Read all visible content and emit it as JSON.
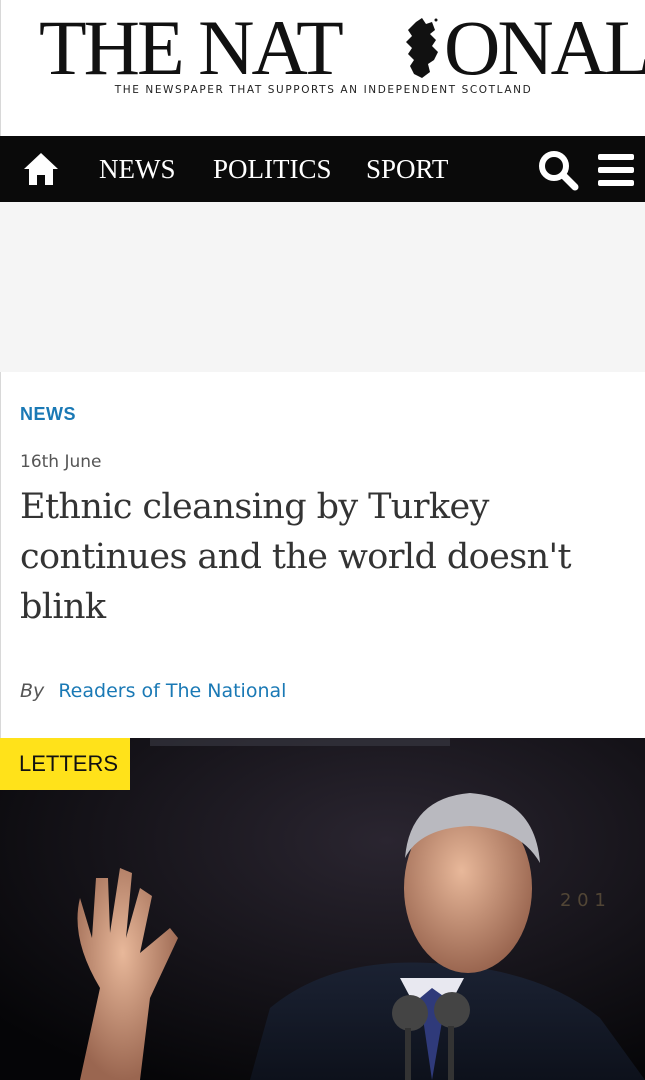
{
  "masthead": {
    "logo_text": "THE NATIONAL",
    "tagline": "THE NEWSPAPER THAT SUPPORTS AN INDEPENDENT SCOTLAND"
  },
  "nav": {
    "items": [
      "NEWS",
      "POLITICS",
      "SPORT"
    ],
    "icons": [
      "home-icon",
      "search-icon",
      "menu-icon"
    ]
  },
  "article": {
    "section": "NEWS",
    "date": "16th June",
    "headline": "Ethnic cleansing by Turkey continues and the world doesn't blink",
    "byline_prefix": "By",
    "author": "Readers of The National"
  },
  "hero": {
    "badge": "LETTERS"
  },
  "colors": {
    "nav_background": "#0a0a0a",
    "link_blue": "#1a79b5",
    "badge_yellow": "#ffe21a"
  }
}
